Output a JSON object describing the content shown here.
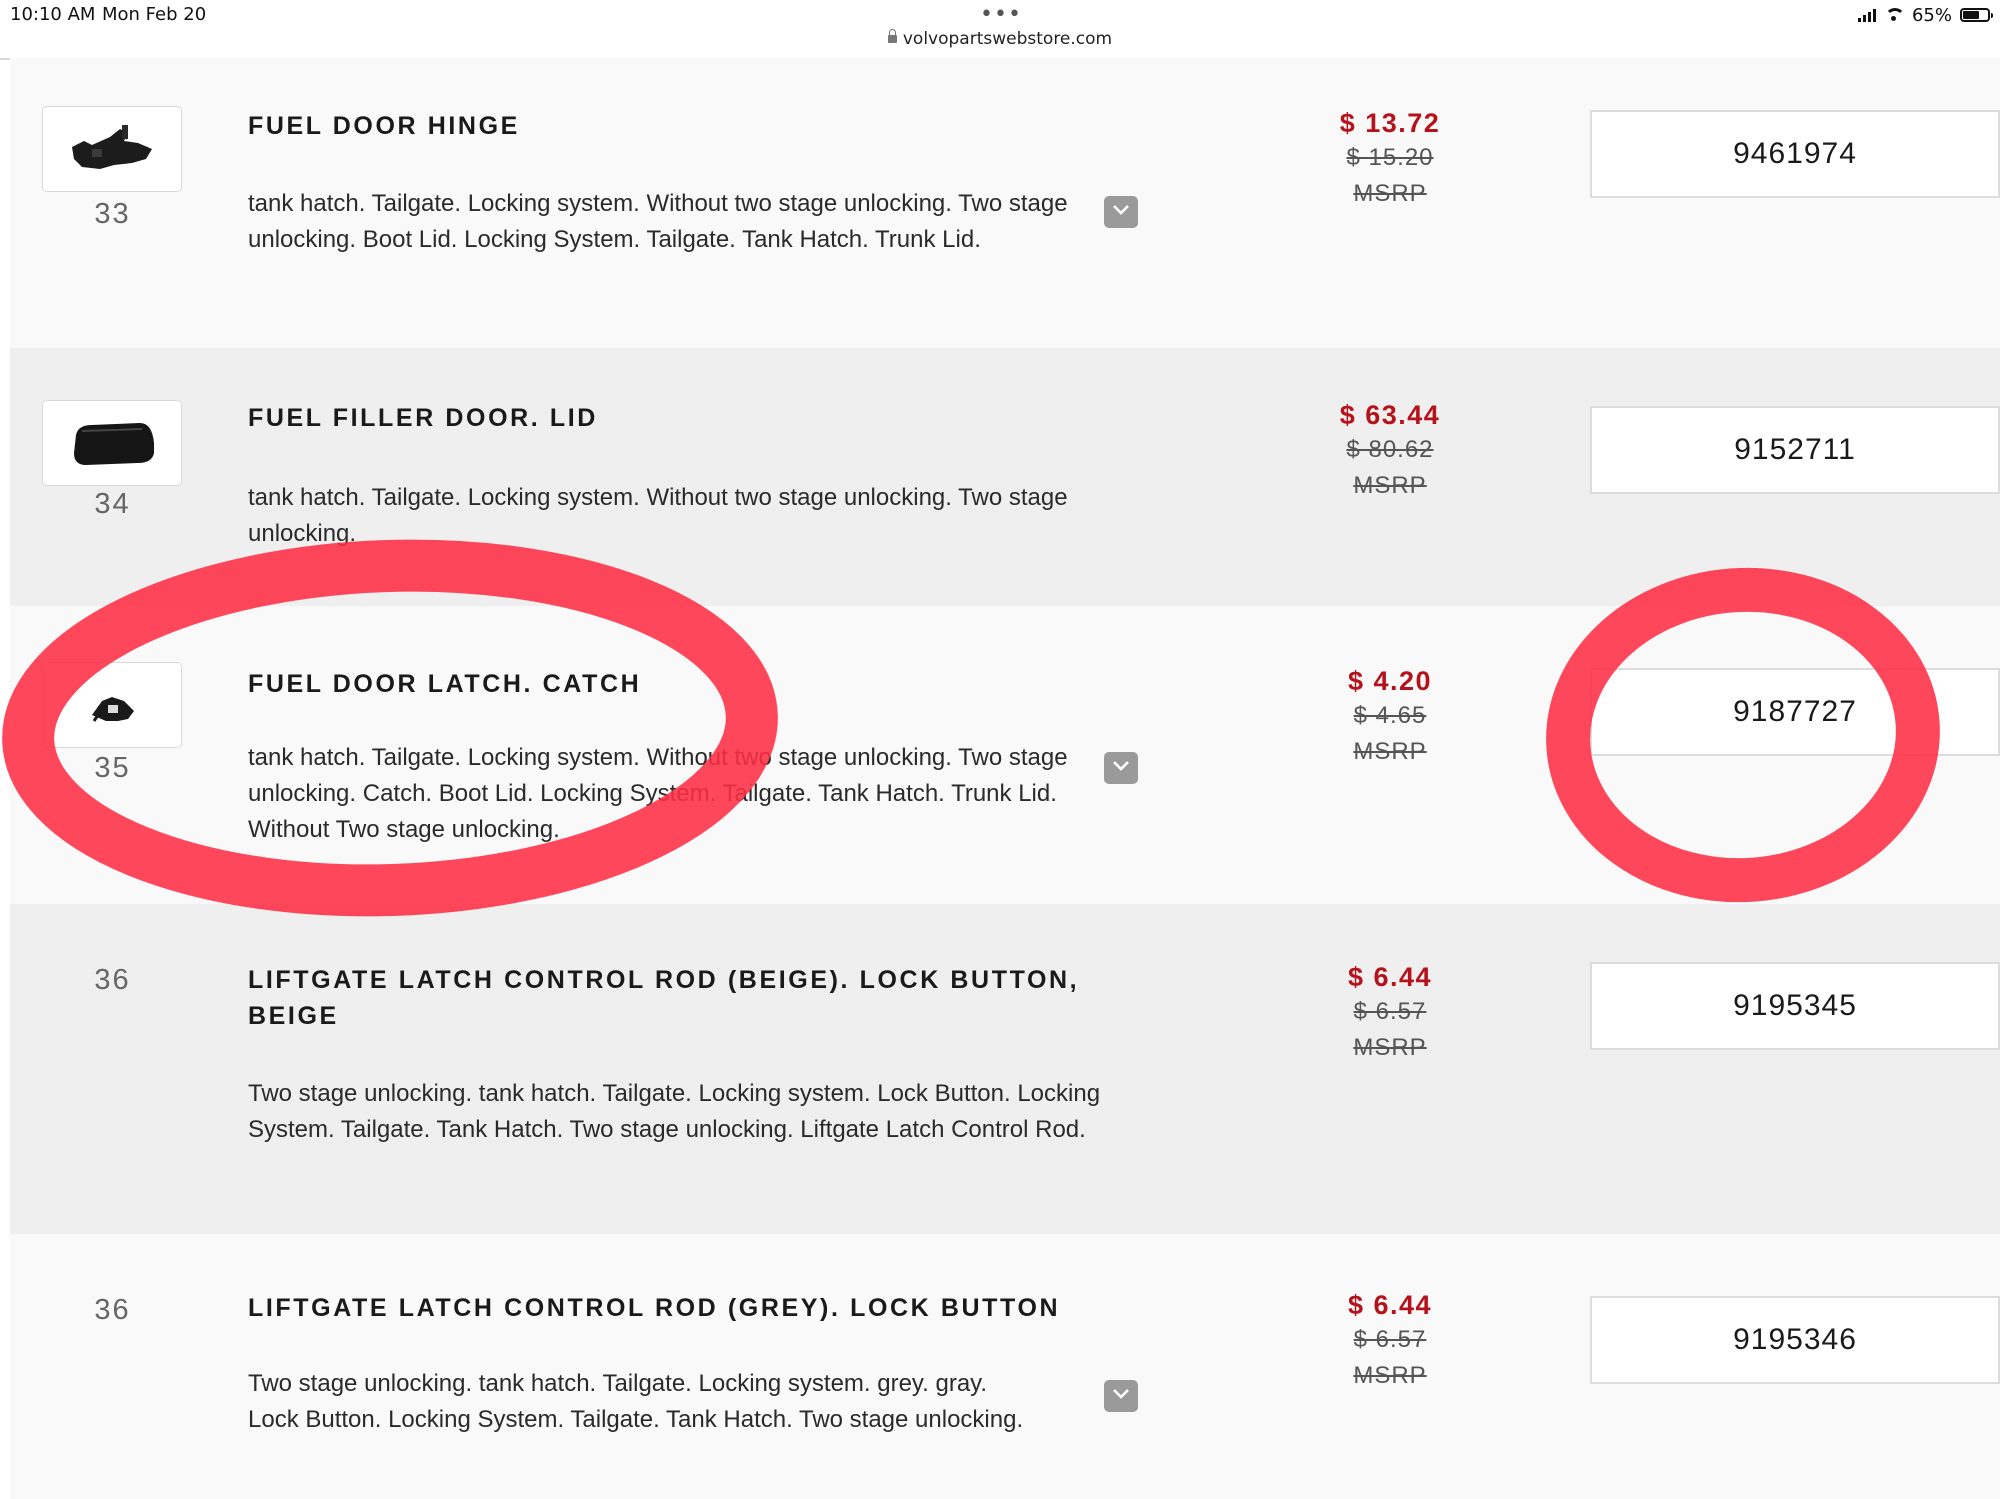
{
  "status_bar": {
    "time": "10:10 AM",
    "date": "Mon Feb 20",
    "url": "volvopartswebstore.com",
    "battery_percent": "65%",
    "battery_level": 0.65,
    "dots": "•••"
  },
  "colors": {
    "price_red": "#b5121b",
    "annotation_red": "#ff2d46",
    "row_light": "#f9f9f9",
    "row_grey": "#efefef"
  },
  "parts": [
    {
      "ref": "33",
      "title": "FUEL DOOR HINGE",
      "description": "tank hatch. Tailgate. Locking system. Without two stage unlocking. Two stage unlocking. Boot Lid. Locking System. Tailgate. Tank Hatch. Trunk Lid.",
      "price": "$ 13.72",
      "msrp": "$ 15.20",
      "msrp_label": "MSRP",
      "part_number": "9461974",
      "has_thumbnail": true,
      "thumbnail_icon": "hinge-part-icon",
      "has_expand": true
    },
    {
      "ref": "34",
      "title": "FUEL FILLER DOOR. LID",
      "description": "tank hatch. Tailgate. Locking system. Without two stage unlocking. Two stage unlocking.",
      "price": "$ 63.44",
      "msrp": "$ 80.62",
      "msrp_label": "MSRP",
      "part_number": "9152711",
      "has_thumbnail": true,
      "thumbnail_icon": "door-lid-part-icon",
      "has_expand": false
    },
    {
      "ref": "35",
      "title": "FUEL DOOR LATCH. CATCH",
      "description": "tank hatch. Tailgate. Locking system. Without two stage unlocking. Two stage unlocking. Catch. Boot Lid. Locking System. Tailgate. Tank Hatch. Trunk Lid. Without Two stage unlocking.",
      "price": "$ 4.20",
      "msrp": "$ 4.65",
      "msrp_label": "MSRP",
      "part_number": "9187727",
      "has_thumbnail": true,
      "thumbnail_icon": "latch-catch-part-icon",
      "has_expand": true
    },
    {
      "ref": "36",
      "title": "LIFTGATE LATCH CONTROL ROD (BEIGE). LOCK BUTTON, BEIGE",
      "description": "Two stage unlocking. tank hatch. Tailgate. Locking system. Lock Button. Locking System. Tailgate. Tank Hatch. Two stage unlocking. Liftgate Latch Control Rod.",
      "price": "$ 6.44",
      "msrp": "$ 6.57",
      "msrp_label": "MSRP",
      "part_number": "9195345",
      "has_thumbnail": false,
      "has_expand": false
    },
    {
      "ref": "36",
      "title": "LIFTGATE LATCH CONTROL ROD (GREY). LOCK BUTTON",
      "description": "Two stage unlocking. tank hatch. Tailgate. Locking system. grey. gray. Lock Button. Locking System. Tailgate. Tank Hatch. Two stage unlocking.",
      "price": "$ 6.44",
      "msrp": "$ 6.57",
      "msrp_label": "MSRP",
      "part_number": "9195346",
      "has_thumbnail": false,
      "has_expand": true
    }
  ]
}
